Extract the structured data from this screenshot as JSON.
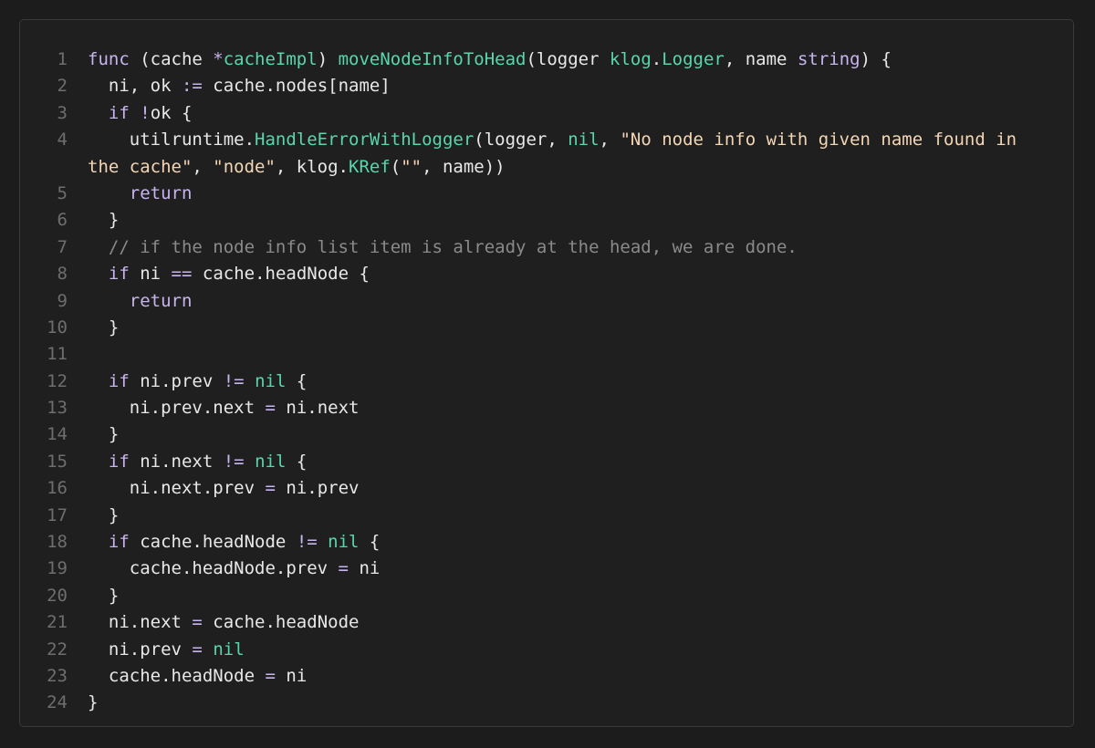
{
  "code_viewer": {
    "language": "go",
    "colors": {
      "background": "#1c1c1c",
      "panel": "#1f1f1f",
      "keyword": "#c8b4ef",
      "function": "#58d6ad",
      "string": "#f4d6b4",
      "comment": "#8a8a8a",
      "text": "#e8e8e8",
      "line_number": "#6e6e6e"
    },
    "lines": [
      {
        "number": "1",
        "tokens": [
          {
            "t": "kw",
            "v": "func"
          },
          {
            "t": "id",
            "v": " (cache "
          },
          {
            "t": "op",
            "v": "*"
          },
          {
            "t": "fn",
            "v": "cacheImpl"
          },
          {
            "t": "id",
            "v": ") "
          },
          {
            "t": "fn",
            "v": "moveNodeInfoToHead"
          },
          {
            "t": "id",
            "v": "(logger "
          },
          {
            "t": "fn",
            "v": "klog"
          },
          {
            "t": "id",
            "v": "."
          },
          {
            "t": "fn",
            "v": "Logger"
          },
          {
            "t": "id",
            "v": ", name "
          },
          {
            "t": "kw",
            "v": "string"
          },
          {
            "t": "id",
            "v": ") {"
          }
        ]
      },
      {
        "number": "2",
        "tokens": [
          {
            "t": "id",
            "v": "  ni, ok "
          },
          {
            "t": "op",
            "v": ":="
          },
          {
            "t": "id",
            "v": " cache.nodes[name]"
          }
        ]
      },
      {
        "number": "3",
        "tokens": [
          {
            "t": "id",
            "v": "  "
          },
          {
            "t": "kw",
            "v": "if"
          },
          {
            "t": "id",
            "v": " "
          },
          {
            "t": "op",
            "v": "!"
          },
          {
            "t": "id",
            "v": "ok {"
          }
        ]
      },
      {
        "number": "4",
        "wrapped": true,
        "tokens": [
          {
            "t": "id",
            "v": "    utilruntime."
          },
          {
            "t": "fn",
            "v": "HandleErrorWithLogger"
          },
          {
            "t": "id",
            "v": "(logger, "
          },
          {
            "t": "fn",
            "v": "nil"
          },
          {
            "t": "id",
            "v": ", "
          },
          {
            "t": "str",
            "v": "\"No node info with given name found in the cache\""
          },
          {
            "t": "id",
            "v": ", "
          },
          {
            "t": "str",
            "v": "\"node\""
          },
          {
            "t": "id",
            "v": ", klog."
          },
          {
            "t": "fn",
            "v": "KRef"
          },
          {
            "t": "id",
            "v": "("
          },
          {
            "t": "str",
            "v": "\"\""
          },
          {
            "t": "id",
            "v": ", name))"
          }
        ]
      },
      {
        "number": "5",
        "tokens": [
          {
            "t": "id",
            "v": "    "
          },
          {
            "t": "kw",
            "v": "return"
          }
        ]
      },
      {
        "number": "6",
        "tokens": [
          {
            "t": "id",
            "v": "  }"
          }
        ]
      },
      {
        "number": "7",
        "tokens": [
          {
            "t": "id",
            "v": "  "
          },
          {
            "t": "cm",
            "v": "// if the node info list item is already at the head, we are done."
          }
        ]
      },
      {
        "number": "8",
        "tokens": [
          {
            "t": "id",
            "v": "  "
          },
          {
            "t": "kw",
            "v": "if"
          },
          {
            "t": "id",
            "v": " ni "
          },
          {
            "t": "op",
            "v": "=="
          },
          {
            "t": "id",
            "v": " cache.headNode {"
          }
        ]
      },
      {
        "number": "9",
        "tokens": [
          {
            "t": "id",
            "v": "    "
          },
          {
            "t": "kw",
            "v": "return"
          }
        ]
      },
      {
        "number": "10",
        "tokens": [
          {
            "t": "id",
            "v": "  }"
          }
        ]
      },
      {
        "number": "11",
        "tokens": []
      },
      {
        "number": "12",
        "tokens": [
          {
            "t": "id",
            "v": "  "
          },
          {
            "t": "kw",
            "v": "if"
          },
          {
            "t": "id",
            "v": " ni.prev "
          },
          {
            "t": "op",
            "v": "!="
          },
          {
            "t": "id",
            "v": " "
          },
          {
            "t": "fn",
            "v": "nil"
          },
          {
            "t": "id",
            "v": " {"
          }
        ]
      },
      {
        "number": "13",
        "tokens": [
          {
            "t": "id",
            "v": "    ni.prev.next "
          },
          {
            "t": "op",
            "v": "="
          },
          {
            "t": "id",
            "v": " ni.next"
          }
        ]
      },
      {
        "number": "14",
        "tokens": [
          {
            "t": "id",
            "v": "  }"
          }
        ]
      },
      {
        "number": "15",
        "tokens": [
          {
            "t": "id",
            "v": "  "
          },
          {
            "t": "kw",
            "v": "if"
          },
          {
            "t": "id",
            "v": " ni.next "
          },
          {
            "t": "op",
            "v": "!="
          },
          {
            "t": "id",
            "v": " "
          },
          {
            "t": "fn",
            "v": "nil"
          },
          {
            "t": "id",
            "v": " {"
          }
        ]
      },
      {
        "number": "16",
        "tokens": [
          {
            "t": "id",
            "v": "    ni.next.prev "
          },
          {
            "t": "op",
            "v": "="
          },
          {
            "t": "id",
            "v": " ni.prev"
          }
        ]
      },
      {
        "number": "17",
        "tokens": [
          {
            "t": "id",
            "v": "  }"
          }
        ]
      },
      {
        "number": "18",
        "tokens": [
          {
            "t": "id",
            "v": "  "
          },
          {
            "t": "kw",
            "v": "if"
          },
          {
            "t": "id",
            "v": " cache.headNode "
          },
          {
            "t": "op",
            "v": "!="
          },
          {
            "t": "id",
            "v": " "
          },
          {
            "t": "fn",
            "v": "nil"
          },
          {
            "t": "id",
            "v": " {"
          }
        ]
      },
      {
        "number": "19",
        "tokens": [
          {
            "t": "id",
            "v": "    cache.headNode.prev "
          },
          {
            "t": "op",
            "v": "="
          },
          {
            "t": "id",
            "v": " ni"
          }
        ]
      },
      {
        "number": "20",
        "tokens": [
          {
            "t": "id",
            "v": "  }"
          }
        ]
      },
      {
        "number": "21",
        "tokens": [
          {
            "t": "id",
            "v": "  ni.next "
          },
          {
            "t": "op",
            "v": "="
          },
          {
            "t": "id",
            "v": " cache.headNode"
          }
        ]
      },
      {
        "number": "22",
        "tokens": [
          {
            "t": "id",
            "v": "  ni.prev "
          },
          {
            "t": "op",
            "v": "="
          },
          {
            "t": "id",
            "v": " "
          },
          {
            "t": "fn",
            "v": "nil"
          }
        ]
      },
      {
        "number": "23",
        "tokens": [
          {
            "t": "id",
            "v": "  cache.headNode "
          },
          {
            "t": "op",
            "v": "="
          },
          {
            "t": "id",
            "v": " ni"
          }
        ]
      },
      {
        "number": "24",
        "tokens": [
          {
            "t": "id",
            "v": "}"
          }
        ]
      }
    ]
  }
}
